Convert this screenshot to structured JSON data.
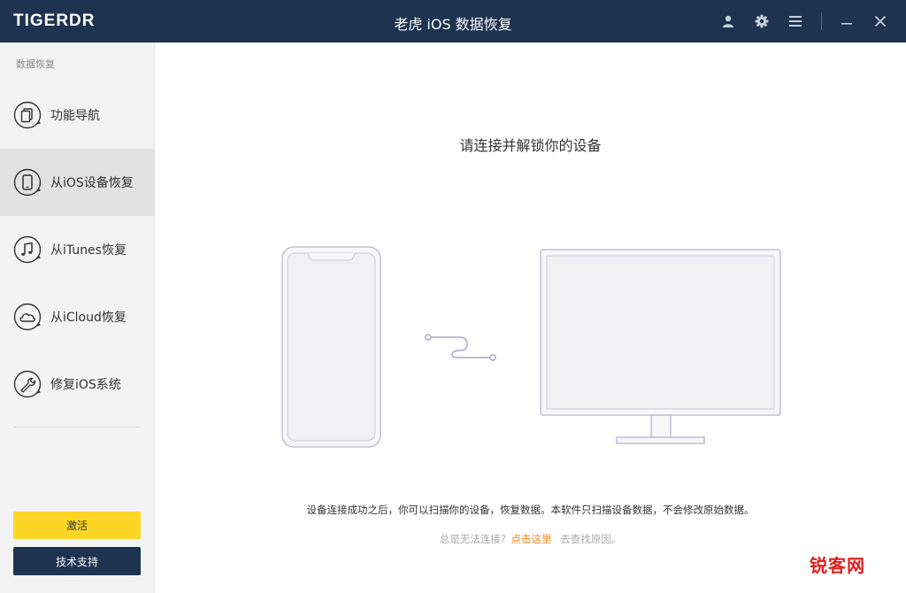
{
  "app": {
    "logo": "TIGERDR",
    "title": "老虎 iOS 数据恢复"
  },
  "titlebar_icons": [
    "user-icon",
    "gear-icon",
    "menu-icon",
    "minimize-icon",
    "close-icon"
  ],
  "sidebar": {
    "heading": "数据恢复",
    "items": [
      {
        "label": "功能导航",
        "icon": "navigation-icon",
        "active": false
      },
      {
        "label": "从iOS设备恢复",
        "icon": "phone-icon",
        "active": true
      },
      {
        "label": "从iTunes恢复",
        "icon": "music-note-icon",
        "active": false
      },
      {
        "label": "从iCloud恢复",
        "icon": "cloud-icon",
        "active": false
      },
      {
        "label": "修复iOS系统",
        "icon": "wrench-icon",
        "active": false
      }
    ],
    "activate_label": "激活",
    "support_label": "技术支持"
  },
  "main": {
    "title": "请连接并解锁你的设备",
    "info": "设备连接成功之后，你可以扫描你的设备，恢复数据。本软件只扫描设备数据，不会修改原始数据。",
    "help_prefix": "总是无法连接?",
    "help_link": "点击这里",
    "help_suffix": "去查找原因。"
  },
  "watermark": "锐客网",
  "colors": {
    "titlebar": "#1d3350",
    "activate": "#fcd624",
    "link": "#f08a1c",
    "watermark": "#e02020"
  }
}
